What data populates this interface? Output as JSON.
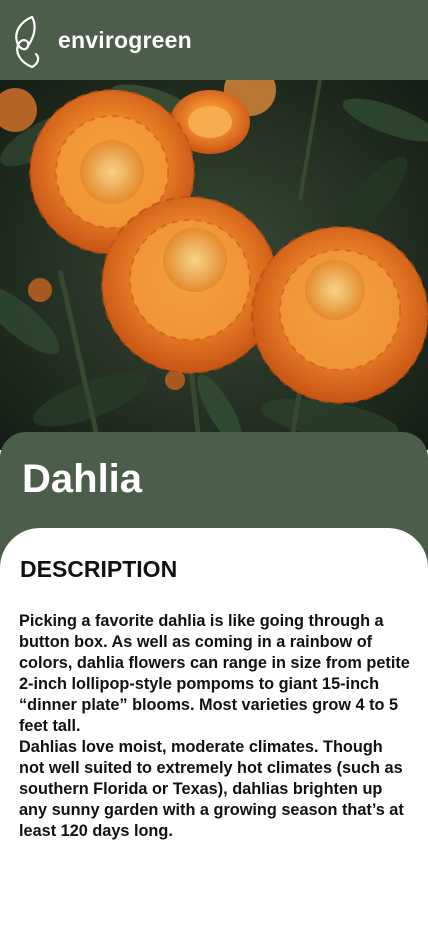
{
  "header": {
    "brand": "envirogreen",
    "logo_icon": "leaf-icon"
  },
  "hero": {
    "image": "dahlia-flowers-photo"
  },
  "plant": {
    "name": "Dahlia"
  },
  "description": {
    "heading": "DESCRIPTION",
    "paragraph_1": "Picking a favorite dahlia is like going through a button box. As well as coming in a rainbow of colors, dahlia flowers can range in size from petite 2-inch lollipop-style pompoms to giant 15-inch “dinner plate” blooms. Most varieties grow 4 to 5 feet tall.",
    "paragraph_2": "Dahlias love moist, moderate climates. Though not well suited to extremely hot climates (such as southern Florida or Texas), dahlias brighten up any sunny garden with a growing season that’s at least 120 days long."
  },
  "colors": {
    "brand_green": "#4a5e4a",
    "background": "#ffffff",
    "text": "#111111"
  }
}
